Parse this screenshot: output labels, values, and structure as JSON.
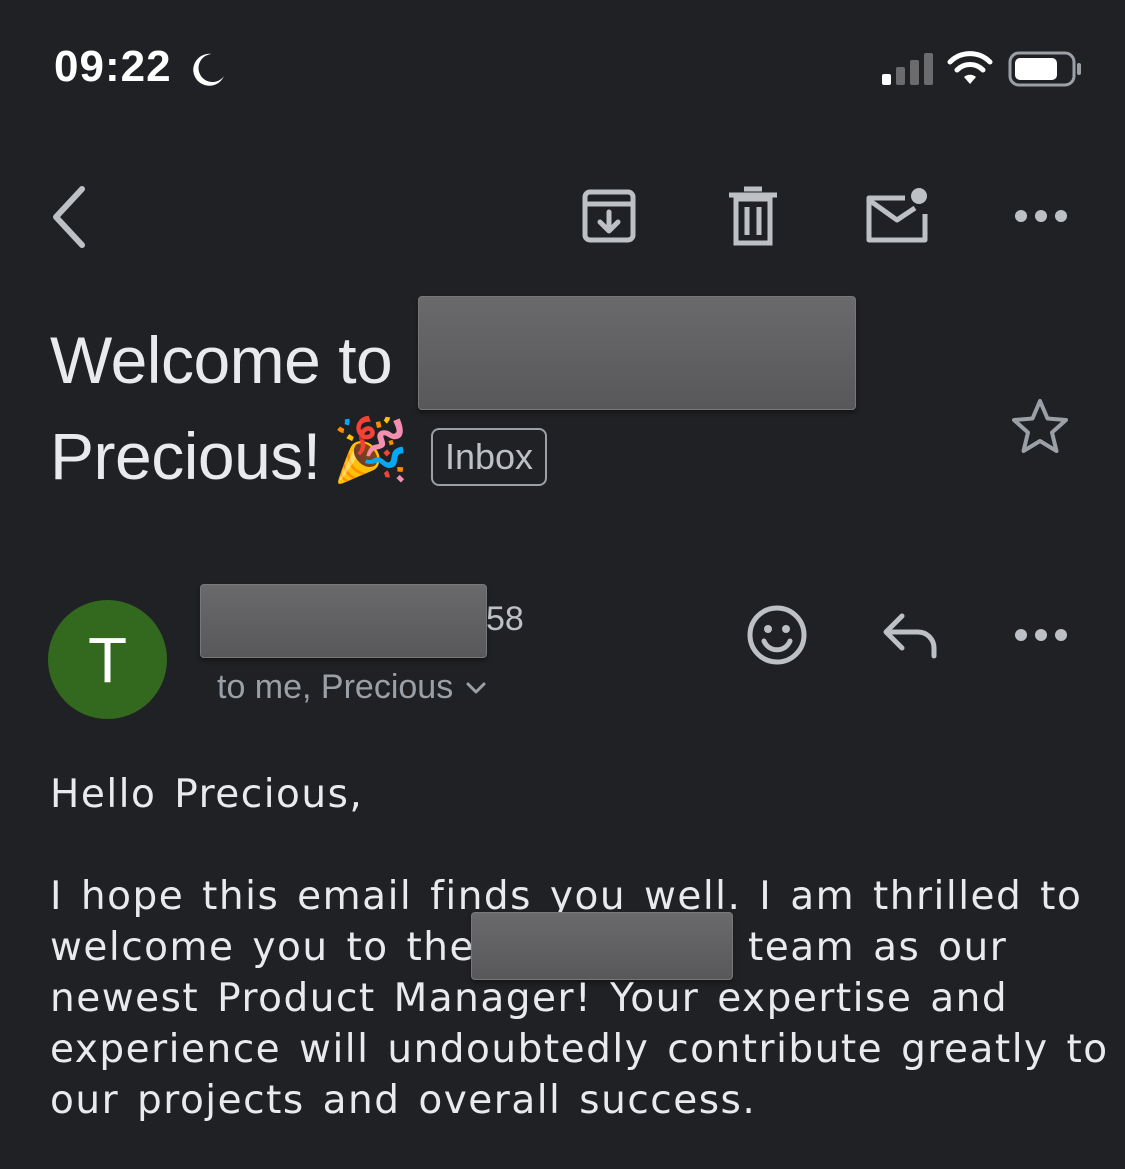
{
  "status_bar": {
    "time": "09:22",
    "focus_icon": "moon-icon",
    "signal_icon": "cellular-signal-icon",
    "wifi_icon": "wifi-icon",
    "battery_icon": "battery-icon"
  },
  "toolbar": {
    "back_icon": "chevron-left-icon",
    "archive_icon": "archive-icon",
    "delete_icon": "trash-icon",
    "mark_unread_icon": "mail-unread-icon",
    "more_icon": "more-horizontal-icon"
  },
  "subject": {
    "line1_prefix": "Welcome to",
    "line2": "Precious!",
    "emoji": "🎉",
    "label": "Inbox",
    "star_icon": "star-outline-icon"
  },
  "sender": {
    "avatar_initial": "T",
    "avatar_color": "#33691e",
    "name_suffix": "58",
    "recipients": "to me, Precious",
    "expand_icon": "chevron-down-icon",
    "emoji_react_icon": "smiley-icon",
    "reply_icon": "reply-icon",
    "more_icon": "more-horizontal-icon"
  },
  "body": {
    "greeting": "Hello Precious,",
    "line1": "I hope this email finds you well. I am thrilled to",
    "line2_prefix": "welcome you to the",
    "line2_suffix": "team as our",
    "line3": "newest Product Manager! Your expertise and",
    "line4": "experience will undoubtedly contribute greatly to",
    "line5": "our projects and overall success."
  },
  "colors": {
    "background": "#202124",
    "text": "#e8eaed",
    "secondary_text": "#9aa0a6",
    "icon": "#bdc1c6"
  }
}
